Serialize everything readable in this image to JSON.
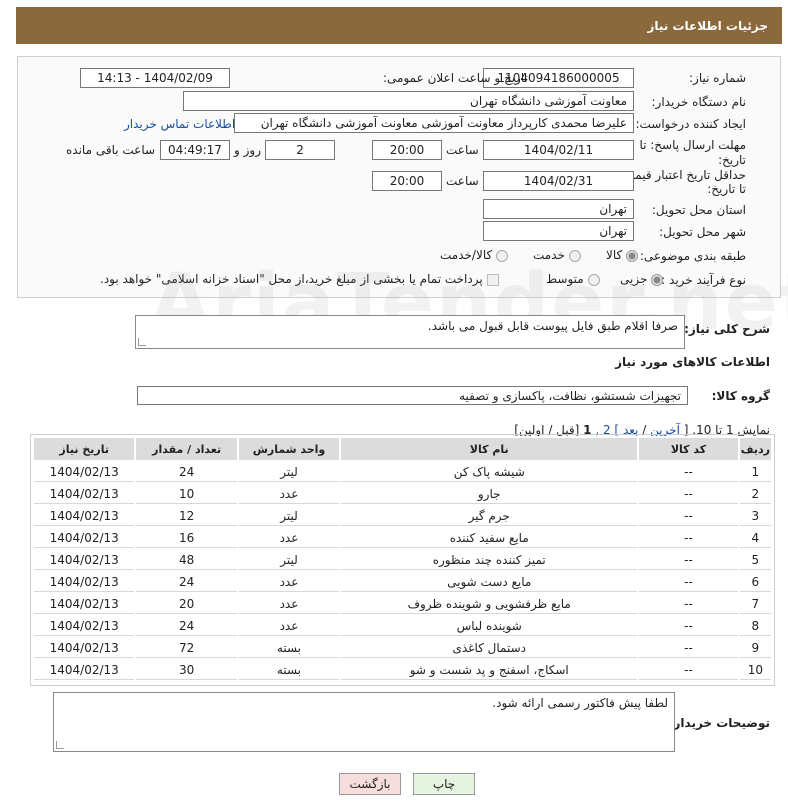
{
  "header": {
    "title": "جزئیات اطلاعات نیاز"
  },
  "form": {
    "need_number_label": "شماره نیاز:",
    "need_number": "1104094186000005",
    "announce_label": "تاریخ و ساعت اعلان عمومی:",
    "announce_value": "1404/02/09 - 14:13",
    "buyer_org_label": "نام دستگاه خریدار:",
    "buyer_org": "معاونت آموزشی دانشگاه تهران",
    "creator_label": "ایجاد کننده درخواست:",
    "creator": "علیرضا محمدی کارپرداز معاونت آموزشی معاونت آموزشی دانشگاه تهران",
    "contact_link": "اطلاعات تماس خریدار",
    "deadline_label_1": "مهلت ارسال پاسخ: تا",
    "deadline_label_2": "تاریخ:",
    "deadline_date": "1404/02/11",
    "time_label": "ساعت",
    "deadline_time": "20:00",
    "days_value": "2",
    "days_label": "روز و",
    "remaining_time": "04:49:17",
    "remaining_label": "ساعت باقی مانده",
    "min_price_label_1": "حداقل تاریخ اعتبار قیمت:",
    "min_price_label_2": "تا تاریخ:",
    "price_date": "1404/02/31",
    "price_time_label": "ساعت",
    "price_time": "20:00",
    "province_label": "استان محل تحویل:",
    "province": "تهران",
    "city_label": "شهر محل تحویل:",
    "city": "تهران",
    "category_label": "طبقه بندی موضوعی:",
    "category_options": [
      "کالا",
      "خدمت",
      "کالا/خدمت"
    ],
    "category_selected": "کالا",
    "process_label": "نوع فرآیند خرید :",
    "process_options": [
      "جزیی",
      "متوسط"
    ],
    "process_selected": "جزیی",
    "payment_note": "پرداخت تمام یا بخشی از مبلغ خرید،از محل \"اسناد خزانه اسلامی\" خواهد بود."
  },
  "watermark": "AriaTender.net",
  "description": {
    "label": "شرح کلی نیاز:",
    "text": "صرفا اقلام طبق فایل پیوست قابل قبول می باشد."
  },
  "goods_info_title": "اطلاعات کالاهای مورد نیاز",
  "goods_group": {
    "label": "گروه کالا:",
    "value": "تجهیزات شستشو، نظافت، پاکسازی و تصفیه"
  },
  "pagination": {
    "prefix": "نمایش 1 تا 10. [",
    "last": "آخرین",
    "sep1": " / ",
    "next": "بعد",
    "middle": "] 2 ,",
    "current": "1",
    "suffix": " [قبل / اولین]"
  },
  "table": {
    "headers": [
      "ردیف",
      "کد کالا",
      "نام کالا",
      "واحد شمارش",
      "تعداد / مقدار",
      "تاریخ نیاز"
    ],
    "rows": [
      [
        "1",
        "--",
        "شیشه پاک کن",
        "لیتر",
        "24",
        "1404/02/13"
      ],
      [
        "2",
        "--",
        "جارو",
        "عدد",
        "10",
        "1404/02/13"
      ],
      [
        "3",
        "--",
        "جرم گیر",
        "لیتر",
        "12",
        "1404/02/13"
      ],
      [
        "4",
        "--",
        "مایع سفید کننده",
        "عدد",
        "16",
        "1404/02/13"
      ],
      [
        "5",
        "--",
        "تمیز کننده چند منظوره",
        "لیتر",
        "48",
        "1404/02/13"
      ],
      [
        "6",
        "--",
        "مایع دست شویی",
        "عدد",
        "24",
        "1404/02/13"
      ],
      [
        "7",
        "--",
        "مایع ظرفشویی و شوینده ظروف",
        "عدد",
        "20",
        "1404/02/13"
      ],
      [
        "8",
        "--",
        "شوینده لباس",
        "عدد",
        "24",
        "1404/02/13"
      ],
      [
        "9",
        "--",
        "دستمال کاغذی",
        "بسته",
        "72",
        "1404/02/13"
      ],
      [
        "10",
        "--",
        "اسکاج، اسفنج و پد شست و شو",
        "بسته",
        "30",
        "1404/02/13"
      ]
    ]
  },
  "buyer_notes": {
    "label": "توضیحات خریدار:",
    "text": "لطفا پیش فاکتور رسمی ارائه شود."
  },
  "buttons": {
    "print": "چاپ",
    "back": "بازگشت"
  },
  "colors": {
    "header_bg": "#8a6a3c",
    "link": "#1a4fa0",
    "back_button_bg": "#f7dede",
    "print_button_bg": "#e6f3e0"
  }
}
